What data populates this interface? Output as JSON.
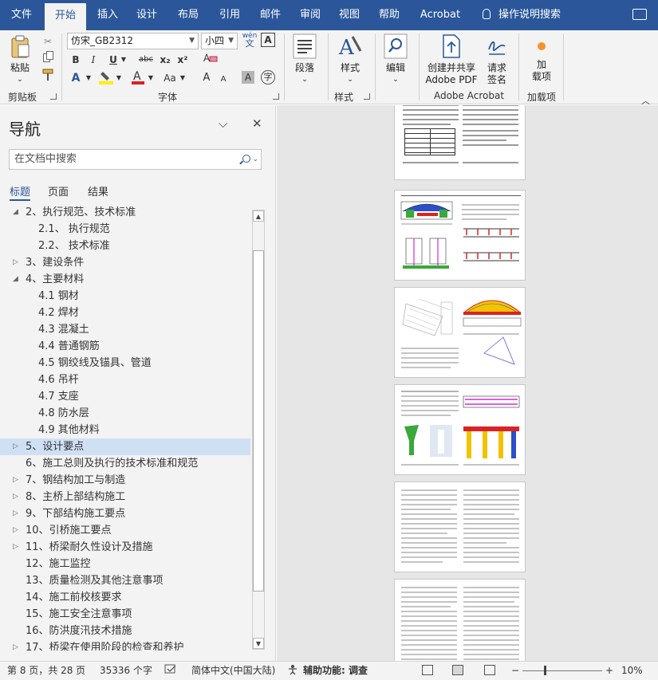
{
  "ribbon_tabs": [
    {
      "label": "文件"
    },
    {
      "label": "开始"
    },
    {
      "label": "插入"
    },
    {
      "label": "设计"
    },
    {
      "label": "布局"
    },
    {
      "label": "引用"
    },
    {
      "label": "邮件"
    },
    {
      "label": "审阅"
    },
    {
      "label": "视图"
    },
    {
      "label": "帮助"
    },
    {
      "label": "Acrobat"
    }
  ],
  "active_tab": "开始",
  "tell_me": "操作说明搜索",
  "ribbon": {
    "paste": "粘贴",
    "clipboard": "剪贴板",
    "font_name": "仿宋_GB2312",
    "font_size": "小四",
    "wen_top": "wén",
    "wen_bottom": "文",
    "font_group": "字体",
    "bold": "B",
    "italic": "I",
    "underline": "U",
    "strike": "abc",
    "subscript": "x₂",
    "superscript": "x²",
    "change_case": "Aa",
    "grow": "A",
    "shrink": "A",
    "char_border": "A",
    "enclose": "字",
    "shading": "A",
    "paragraph": "段落",
    "styles": "样式",
    "styles_group": "样式",
    "editing": "编辑",
    "create_share_1": "创建并共享",
    "create_share_2": "Adobe PDF",
    "request_sign_1": "请求",
    "request_sign_2": "签名",
    "acrobat_group": "Adobe Acrobat",
    "addins_1": "加",
    "addins_2": "载项",
    "addins_group": "加载项"
  },
  "nav": {
    "title": "导航",
    "search_placeholder": "在文档中搜索",
    "tabs": [
      {
        "label": "标题"
      },
      {
        "label": "页面"
      },
      {
        "label": "结果"
      }
    ],
    "items": [
      {
        "label": "2、执行规范、技术标准",
        "level": 1,
        "toggle": "expanded"
      },
      {
        "label": "2.1、 执行规范",
        "level": 2,
        "toggle": "none"
      },
      {
        "label": "2.2、 技术标准",
        "level": 2,
        "toggle": "none"
      },
      {
        "label": "3、建设条件",
        "level": 1,
        "toggle": "collapsed"
      },
      {
        "label": "4、主要材料",
        "level": 1,
        "toggle": "expanded"
      },
      {
        "label": "4.1 钢材",
        "level": 2,
        "toggle": "none"
      },
      {
        "label": "4.2 焊材",
        "level": 2,
        "toggle": "none"
      },
      {
        "label": "4.3 混凝土",
        "level": 2,
        "toggle": "none"
      },
      {
        "label": "4.4 普通钢筋",
        "level": 2,
        "toggle": "none"
      },
      {
        "label": "4.5 钢绞线及锚具、管道",
        "level": 2,
        "toggle": "none"
      },
      {
        "label": "4.6 吊杆",
        "level": 2,
        "toggle": "none"
      },
      {
        "label": "4.7 支座",
        "level": 2,
        "toggle": "none"
      },
      {
        "label": "4.8 防水层",
        "level": 2,
        "toggle": "none"
      },
      {
        "label": "4.9 其他材料",
        "level": 2,
        "toggle": "none"
      },
      {
        "label": "5、设计要点",
        "level": 1,
        "toggle": "collapsed",
        "selected": true
      },
      {
        "label": "6、施工总则及执行的技术标准和规范",
        "level": 1,
        "toggle": "none"
      },
      {
        "label": "7、钢结构加工与制造",
        "level": 1,
        "toggle": "collapsed"
      },
      {
        "label": "8、主桥上部结构施工",
        "level": 1,
        "toggle": "collapsed"
      },
      {
        "label": "9、下部结构施工要点",
        "level": 1,
        "toggle": "collapsed"
      },
      {
        "label": "10、引桥施工要点",
        "level": 1,
        "toggle": "collapsed"
      },
      {
        "label": "11、桥梁耐久性设计及措施",
        "level": 1,
        "toggle": "collapsed"
      },
      {
        "label": "12、施工监控",
        "level": 1,
        "toggle": "none"
      },
      {
        "label": "13、质量检测及其他注意事项",
        "level": 1,
        "toggle": "none"
      },
      {
        "label": "14、施工前校核要求",
        "level": 1,
        "toggle": "none"
      },
      {
        "label": "15、施工安全注意事项",
        "level": 1,
        "toggle": "none"
      },
      {
        "label": "16、防洪度汛技术措施",
        "level": 1,
        "toggle": "none"
      },
      {
        "label": "17、桥梁在使用阶段的检查和养护",
        "level": 1,
        "toggle": "collapsed"
      }
    ]
  },
  "status": {
    "page": "第 8 页，共 28 页",
    "words": "35336 个字",
    "language": "简体中文(中国大陆)",
    "accessibility": "辅助功能: 调查",
    "zoom_minus": "−",
    "zoom_plus": "+",
    "zoom": "10%"
  },
  "icons": {
    "toggle_expanded": "◢",
    "toggle_collapsed": "▷",
    "chevron": "⌵",
    "close": "✕"
  },
  "colors": {
    "accent": "#2b579a",
    "selection": "#cfe0f5"
  }
}
